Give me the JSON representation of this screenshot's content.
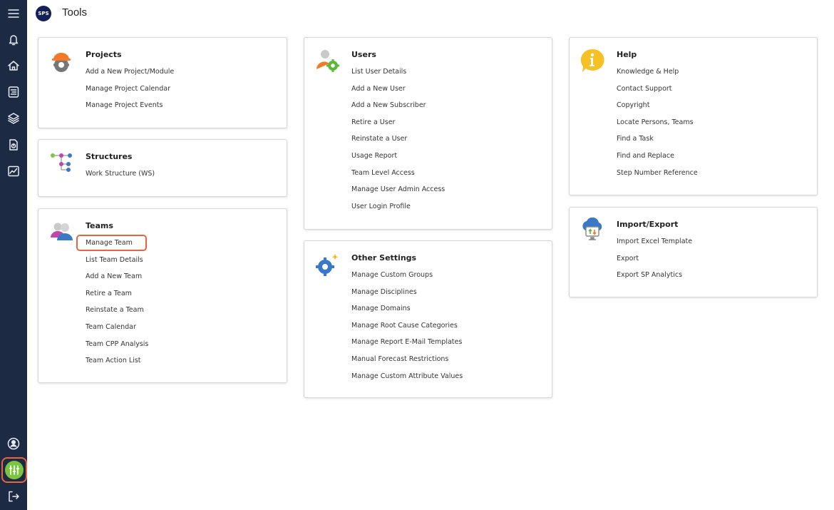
{
  "header": {
    "logo_text": "SPS",
    "title": "Tools"
  },
  "sidebar": {
    "items": [
      {
        "icon": "menu-icon"
      },
      {
        "icon": "bell-icon"
      },
      {
        "icon": "home-icon"
      },
      {
        "icon": "document-list-icon"
      },
      {
        "icon": "layers-icon"
      },
      {
        "icon": "report-icon"
      },
      {
        "icon": "analytics-chart-icon"
      },
      {
        "icon": "user-profile-icon"
      },
      {
        "icon": "tools-sliders-icon",
        "active": true
      },
      {
        "icon": "logout-icon"
      }
    ],
    "active_color": "#7cc540",
    "highlight_color": "#e8643c"
  },
  "cards": {
    "projects": {
      "title": "Projects",
      "icon": "hardhat-gear-icon",
      "links": [
        "Add a New Project/Module",
        "Manage Project Calendar",
        "Manage Project Events"
      ]
    },
    "structures": {
      "title": "Structures",
      "icon": "tree-structure-icon",
      "links": [
        "Work Structure (WS)"
      ]
    },
    "teams": {
      "title": "Teams",
      "icon": "team-people-icon",
      "links": [
        "Manage Team",
        "List Team Details",
        "Add a New Team",
        "Retire a Team",
        "Reinstate a Team",
        "Team Calendar",
        "Team CPP Analysis",
        "Team Action List"
      ],
      "highlighted": "Manage Team"
    },
    "users": {
      "title": "Users",
      "icon": "user-gear-icon",
      "links": [
        "List User Details",
        "Add a New User",
        "Add a New Subscriber",
        "Retire a User",
        "Reinstate a User",
        "Usage Report",
        "Team Level Access",
        "Manage User Admin Access",
        "User Login Profile"
      ]
    },
    "other_settings": {
      "title": "Other Settings",
      "icon": "settings-gear-icon",
      "links": [
        "Manage Custom Groups",
        "Manage Disciplines",
        "Manage Domains",
        "Manage Root Cause Categories",
        "Manage Report E-Mail Templates",
        "Manual Forecast Restrictions",
        "Manage Custom Attribute Values"
      ]
    },
    "help": {
      "title": "Help",
      "icon": "info-bubble-icon",
      "links": [
        "Knowledge & Help",
        "Contact Support",
        "Copyright",
        "Locate Persons, Teams",
        "Find a Task",
        "Find and Replace",
        "Step Number Reference"
      ]
    },
    "import_export": {
      "title": "Import/Export",
      "icon": "cloud-monitor-icon",
      "links": [
        "Import Excel Template",
        "Export",
        "Export SP Analytics"
      ]
    }
  }
}
